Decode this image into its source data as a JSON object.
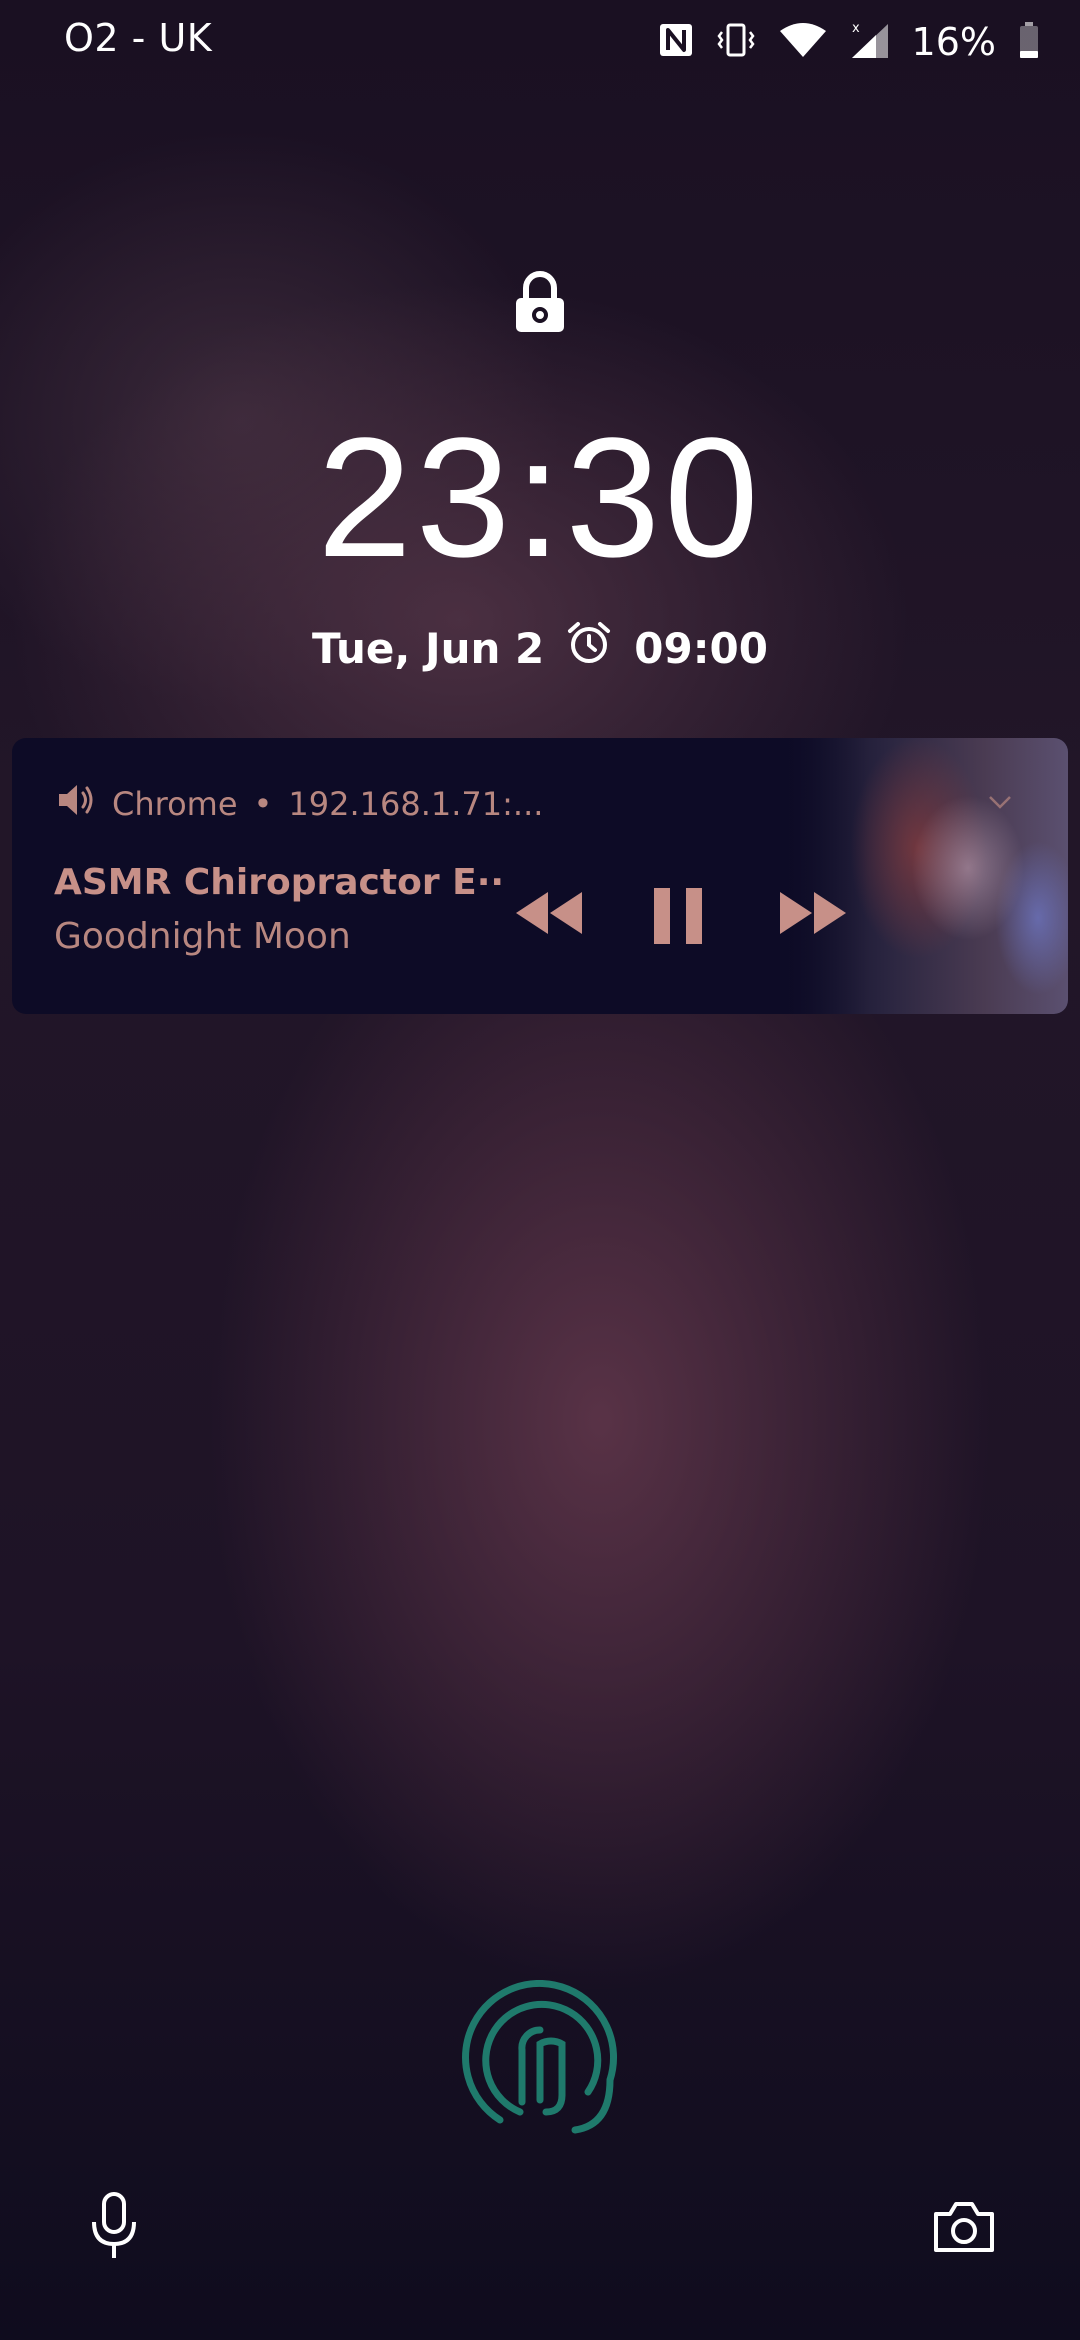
{
  "status_bar": {
    "carrier": "O2 - UK",
    "battery_percent": "16%",
    "icons": [
      "nfc-icon",
      "vibrate-icon",
      "wifi-icon",
      "signal-icon",
      "battery-icon"
    ]
  },
  "lock_screen": {
    "time": "23:30",
    "date": "Tue, Jun 2",
    "alarm_time": "09:00"
  },
  "media": {
    "app_name": "Chrome",
    "separator": "•",
    "source": "192.168.1.71:...",
    "title": "ASMR Chiropractor E··",
    "artist": "Goodnight Moon",
    "state": "playing",
    "controls": [
      "rewind",
      "pause",
      "fast-forward"
    ],
    "accent_color": "#c79088"
  },
  "shortcuts": {
    "left": "microphone-icon",
    "right": "camera-icon"
  },
  "colors": {
    "fingerprint": "#1f7a6c",
    "card_background": "#0d0b26"
  }
}
